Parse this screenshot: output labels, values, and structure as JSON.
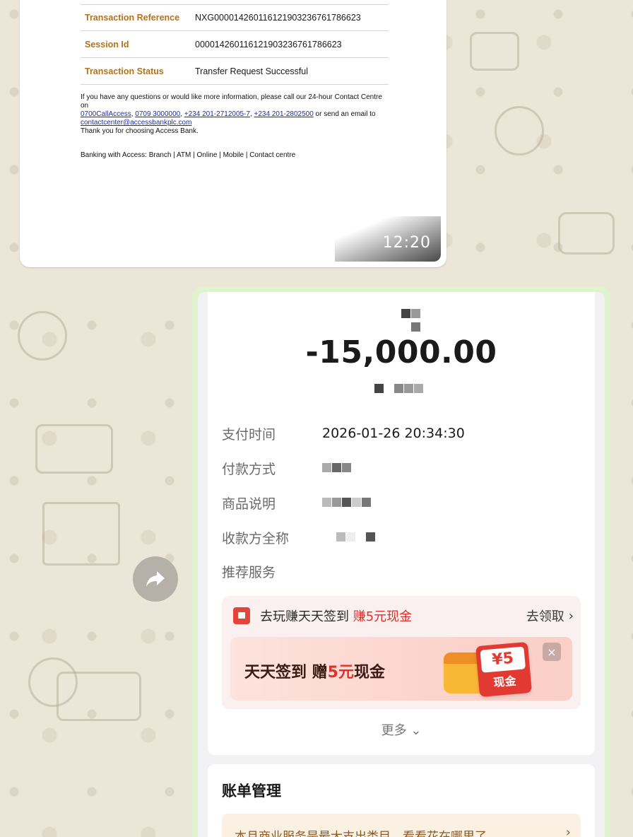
{
  "receipt": {
    "rows": [
      {
        "label": "Transaction Reference",
        "value": "NXG000014260116121903236761786623"
      },
      {
        "label": "Session Id",
        "value": "000014260116121903236761786623"
      },
      {
        "label": "Transaction Status",
        "value": "Transfer Request Successful"
      }
    ],
    "contact_line": "If you have any questions or would like more information, please call our 24-hour Contact Centre on",
    "phone_1": "0700CallAccess",
    "phone_2": "0709 3000000",
    "phone_3": "+234 201-2712005-7",
    "phone_4": "+234 201-2802500",
    "email_prefix": "or send an email to",
    "email": "contactcenter@accessbankplc.com",
    "thanks": "Thank you for choosing Access Bank.",
    "channels": "Banking with Access: Branch | ATM | Online | Mobile | Contact centre",
    "time": "12:20"
  },
  "payment": {
    "amount": "-15,000.00",
    "rows": [
      {
        "label": "支付时间",
        "value": "2026-01-26 20:34:30"
      },
      {
        "label": "付款方式",
        "value": ""
      },
      {
        "label": "商品说明",
        "value": ""
      },
      {
        "label": "收款方全称",
        "value": ""
      },
      {
        "label": "推荐服务",
        "value": ""
      }
    ],
    "promo": {
      "title_prefix": "去玩赚天天签到 ",
      "title_highlight": "赚5元现金",
      "link": "去领取",
      "banner_prefix": "天天签到 赠",
      "banner_highlight": "5元",
      "banner_suffix": "现金",
      "cash_value": "¥5",
      "cash_label": "现金",
      "close": "×"
    },
    "more": "更多",
    "bill": {
      "title": "账单管理",
      "tip": "本月商业服务是最大支出类目，看看花在哪里了"
    }
  },
  "colors": {
    "accent_red": "#e0322c",
    "receipt_label": "#b0721f",
    "bubble_green": "#dff3cf"
  }
}
